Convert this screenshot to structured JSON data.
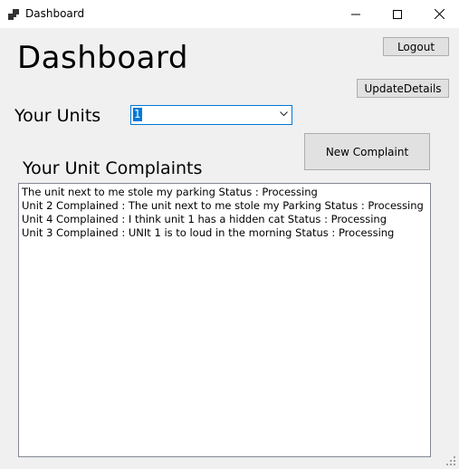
{
  "window": {
    "title": "Dashboard",
    "icon": "app-window-icon",
    "controls": [
      "minimize-icon",
      "maximize-icon",
      "close-icon"
    ]
  },
  "header": {
    "title": "Dashboard"
  },
  "buttons": {
    "logout": "Logout",
    "update_details": "UpdateDetails",
    "new_complaint": "New Complaint"
  },
  "units": {
    "label": "Your Units",
    "selected": "1"
  },
  "complaints": {
    "label": "Your Unit Complaints",
    "items": [
      "The unit next to me stole my parking Status : Processing",
      "Unit 2 Complained : The unit next to me stole my Parking Status : Processing",
      "Unit 4 Complained : I think unit 1 has a hidden cat Status : Processing",
      "Unit 3 Complained : UNIt 1 is to loud in the morning Status : Processing"
    ]
  },
  "colors": {
    "accent": "#0078d7",
    "window_bg": "#f0f0f0",
    "button_bg": "#e1e1e1"
  }
}
